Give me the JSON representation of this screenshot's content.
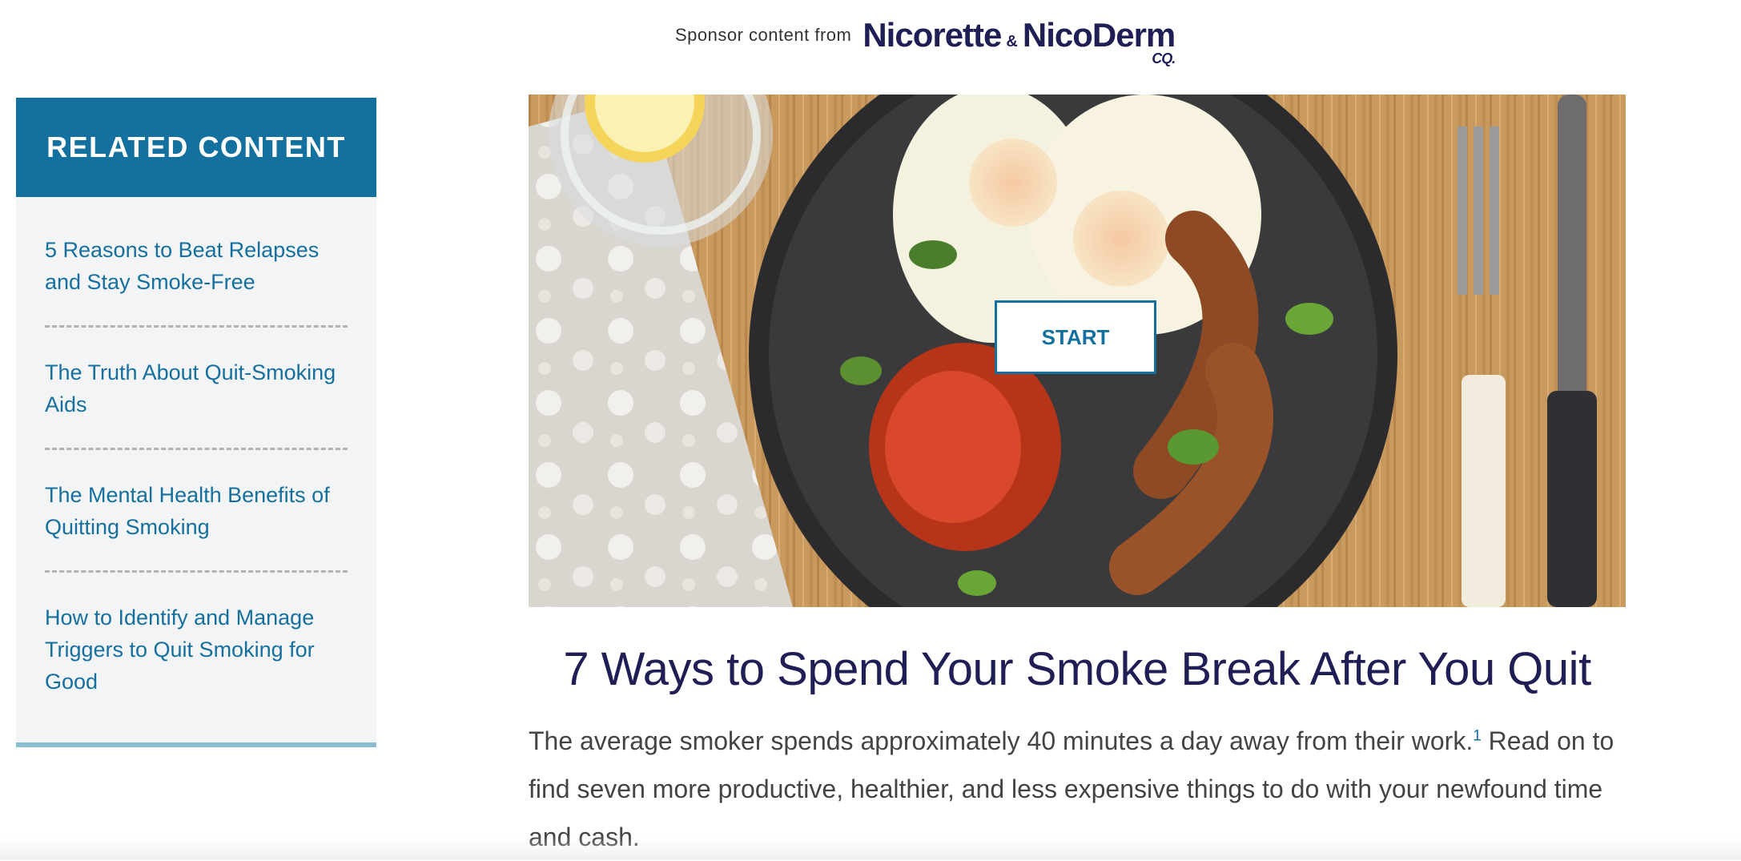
{
  "sponsor": {
    "text": "Sponsor content from",
    "brand_primary": "Nicorette",
    "brand_amp": "&",
    "brand_secondary": "NicoDerm",
    "brand_suffix": "CQ."
  },
  "sidebar": {
    "title": "RELATED CONTENT",
    "items": [
      {
        "label": "5 Reasons to Beat Relapses and Stay Smoke-Free"
      },
      {
        "label": "The Truth About Quit-Smoking Aids"
      },
      {
        "label": "The Mental Health Benefits of Quitting Smoking"
      },
      {
        "label": "How to Identify and Manage Triggers to Quit Smoking for Good"
      }
    ]
  },
  "hero": {
    "start_label": "START"
  },
  "article": {
    "title": "7 Ways to Spend Your Smoke Break After You Quit",
    "intro_part1": "The average smoker spends approximately 40 minutes a day away from their work.",
    "footnote": "1",
    "intro_part2": " Read on to find seven more productive, healthier, and less expensive things to do with your newfound time and cash."
  },
  "colors": {
    "accent": "#14709f",
    "title_navy": "#1f1e55",
    "sidebar_bg": "#f3f4f5",
    "sidebar_border": "#8bbdd1"
  }
}
